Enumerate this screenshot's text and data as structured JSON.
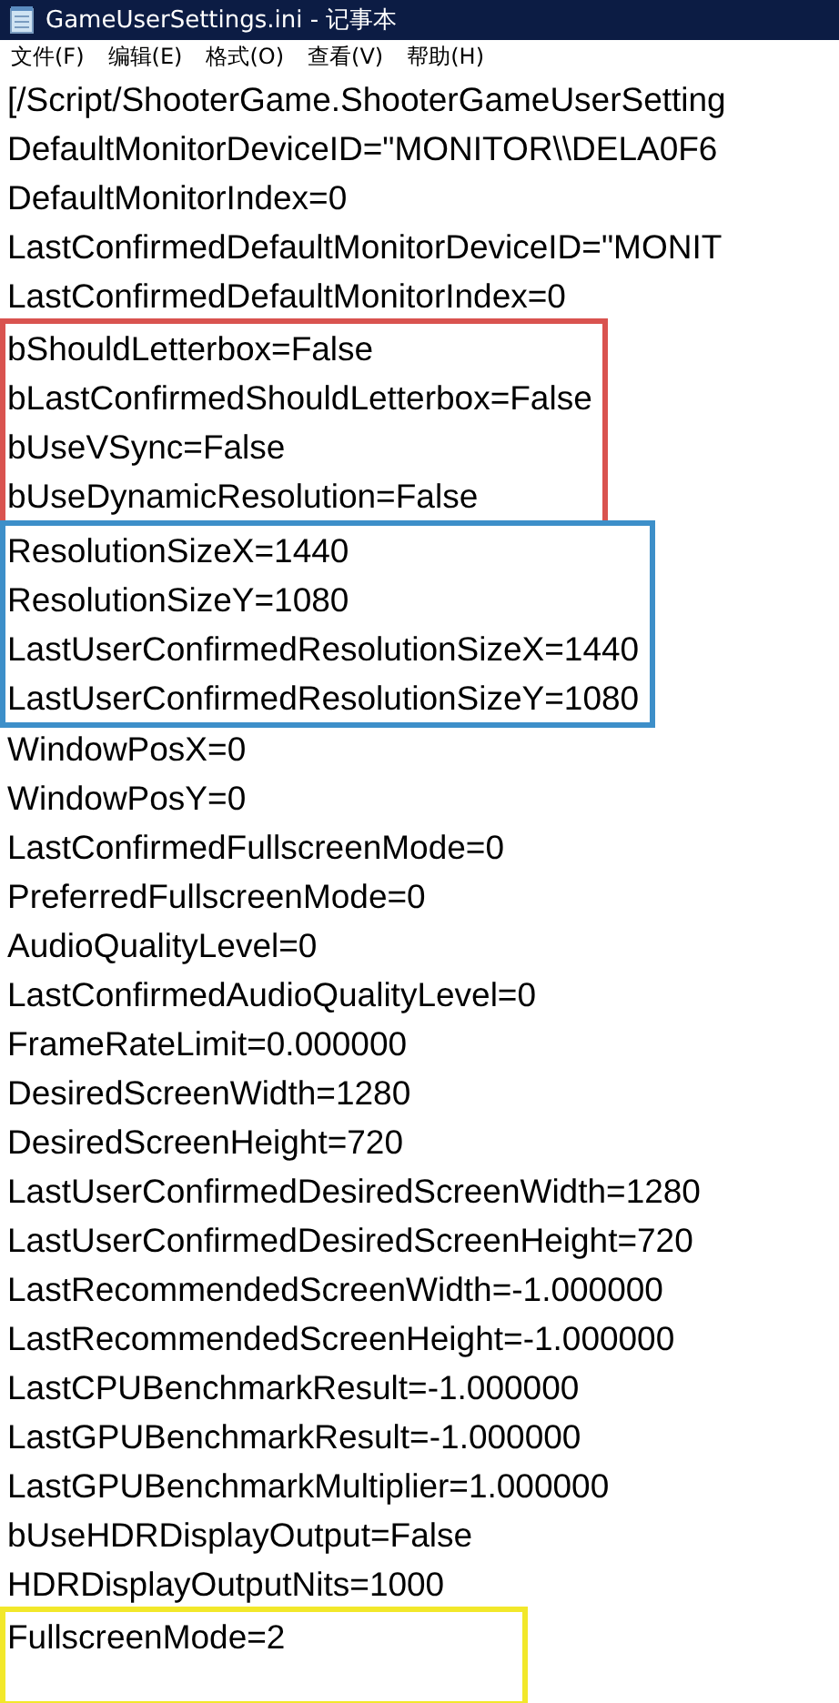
{
  "window": {
    "title": "GameUserSettings.ini - 记事本"
  },
  "menu": [
    "文件(F)",
    "编辑(E)",
    "格式(O)",
    "查看(V)",
    "帮助(H)"
  ],
  "text_blocks": [
    {
      "lines": [
        "[/Script/ShooterGame.ShooterGameUserSetting",
        "DefaultMonitorDeviceID=\"MONITOR\\\\DELA0F6",
        "DefaultMonitorIndex=0",
        "LastConfirmedDefaultMonitorDeviceID=\"MONIT",
        "LastConfirmedDefaultMonitorIndex=0"
      ]
    },
    {
      "color": "#d9534f",
      "lines": [
        "bShouldLetterbox=False",
        "bLastConfirmedShouldLetterbox=False",
        "bUseVSync=False",
        "bUseDynamicResolution=False"
      ]
    },
    {
      "color": "#3d8fc9",
      "lines": [
        "ResolutionSizeX=1440",
        "ResolutionSizeY=1080",
        "LastUserConfirmedResolutionSizeX=1440",
        "LastUserConfirmedResolutionSizeY=1080"
      ]
    },
    {
      "lines": [
        "WindowPosX=0",
        "WindowPosY=0",
        "LastConfirmedFullscreenMode=0",
        "PreferredFullscreenMode=0",
        "AudioQualityLevel=0",
        "LastConfirmedAudioQualityLevel=0",
        "FrameRateLimit=0.000000",
        "DesiredScreenWidth=1280",
        "DesiredScreenHeight=720",
        "LastUserConfirmedDesiredScreenWidth=1280",
        "LastUserConfirmedDesiredScreenHeight=720",
        "LastRecommendedScreenWidth=-1.000000",
        "LastRecommendedScreenHeight=-1.000000",
        "LastCPUBenchmarkResult=-1.000000",
        "LastGPUBenchmarkResult=-1.000000",
        "LastGPUBenchmarkMultiplier=1.000000",
        "bUseHDRDisplayOutput=False",
        "HDRDisplayOutputNits=1000"
      ]
    },
    {
      "color": "#f2e82a",
      "lines": [
        "FullscreenMode=2"
      ]
    }
  ]
}
